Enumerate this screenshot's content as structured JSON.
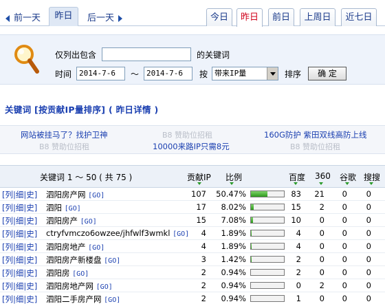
{
  "nav": {
    "prev_day": "前一天",
    "current_day": "昨日",
    "next_day": "后一天",
    "tabs": [
      {
        "label": "今日",
        "active": false
      },
      {
        "label": "昨日",
        "active": true
      },
      {
        "label": "前日",
        "active": false
      },
      {
        "label": "上周日",
        "active": false
      },
      {
        "label": "近七日",
        "active": false
      }
    ]
  },
  "search": {
    "contains_label": "仅列出包含",
    "contains_value": "",
    "contains_suffix": "的关键词",
    "time_label": "时间",
    "date_from": "2014-7-6",
    "range_sep": "～",
    "date_to": "2014-7-6",
    "by_label": "按",
    "sort_field": "带来IP量",
    "sort_label": "排序",
    "confirm_button": "确 定"
  },
  "heading": "关键词 [按贡献IP量排序] ( 昨日详情 )",
  "ads": [
    {
      "text": "网站被挂马了？找护卫神",
      "type": "link"
    },
    {
      "text": "B8 赞助位招租",
      "type": "grey"
    },
    {
      "text": "160G防护 紫田双线高防上线",
      "type": "link"
    },
    {
      "text": "B8 赞助位招租",
      "type": "grey"
    },
    {
      "text": "10000来路IP只需8元",
      "type": "link"
    },
    {
      "text": "B8 赞助位招租",
      "type": "grey"
    }
  ],
  "table": {
    "headers": {
      "keyword": "关键词 1 ～ 50 ( 共 75 )",
      "ip": "贡献IP",
      "ratio": "比例",
      "baidu": "百度",
      "s360": "360",
      "google": "谷歌",
      "sogou": "搜搜"
    },
    "row_actions": [
      "[列",
      "|细|",
      "史]"
    ],
    "go_label": "[GO]",
    "rows": [
      {
        "keyword": "泗阳房产网",
        "ip": "107",
        "ratio": "50.47%",
        "ratio_value": 50.47,
        "baidu": "83",
        "s360": "21",
        "google": "0",
        "sogou": "0"
      },
      {
        "keyword": "泗阳",
        "ip": "17",
        "ratio": "8.02%",
        "ratio_value": 8.02,
        "baidu": "15",
        "s360": "2",
        "google": "0",
        "sogou": "0"
      },
      {
        "keyword": "泗阳房产",
        "ip": "15",
        "ratio": "7.08%",
        "ratio_value": 7.08,
        "baidu": "10",
        "s360": "0",
        "google": "0",
        "sogou": "0"
      },
      {
        "keyword": "ctryfvmczo6owzee/jhfwlf3wmkl",
        "ip": "4",
        "ratio": "1.89%",
        "ratio_value": 1.89,
        "baidu": "4",
        "s360": "0",
        "google": "0",
        "sogou": "0"
      },
      {
        "keyword": "泗阳房地产",
        "ip": "4",
        "ratio": "1.89%",
        "ratio_value": 1.89,
        "baidu": "4",
        "s360": "0",
        "google": "0",
        "sogou": "0"
      },
      {
        "keyword": "泗阳房产新楼盘",
        "ip": "3",
        "ratio": "1.42%",
        "ratio_value": 1.42,
        "baidu": "2",
        "s360": "0",
        "google": "0",
        "sogou": "0"
      },
      {
        "keyword": "泗阳房",
        "ip": "2",
        "ratio": "0.94%",
        "ratio_value": 0.94,
        "baidu": "2",
        "s360": "0",
        "google": "0",
        "sogou": "0"
      },
      {
        "keyword": "泗阳房地产网",
        "ip": "2",
        "ratio": "0.94%",
        "ratio_value": 0.94,
        "baidu": "0",
        "s360": "2",
        "google": "0",
        "sogou": "0"
      },
      {
        "keyword": "泗阳二手房产网",
        "ip": "2",
        "ratio": "0.94%",
        "ratio_value": 0.94,
        "baidu": "1",
        "s360": "0",
        "google": "0",
        "sogou": "0"
      }
    ]
  },
  "colors": {
    "accent": "#1a3fb0",
    "active_tab": "#d0021b",
    "bar_fill": "#2e9a1e"
  }
}
